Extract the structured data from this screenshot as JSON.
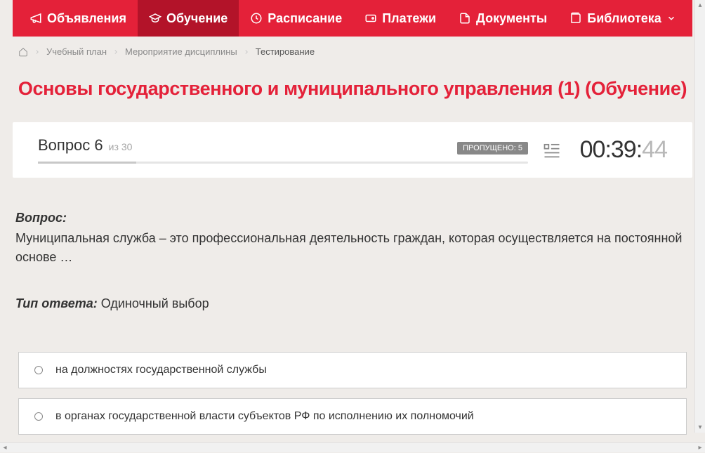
{
  "nav": [
    {
      "label": "Объявления",
      "icon": "megaphone-icon"
    },
    {
      "label": "Обучение",
      "icon": "graduation-icon",
      "active": true
    },
    {
      "label": "Расписание",
      "icon": "clock-icon"
    },
    {
      "label": "Платежи",
      "icon": "wallet-icon"
    },
    {
      "label": "Документы",
      "icon": "document-icon"
    },
    {
      "label": "Библиотека",
      "icon": "book-icon",
      "has_dropdown": true
    }
  ],
  "breadcrumb": {
    "items": [
      {
        "label": "Учебный план"
      },
      {
        "label": "Мероприятие дисциплины"
      }
    ],
    "current": "Тестирование"
  },
  "page_title": "Основы государственного и муниципального управления (1) (Обучение)",
  "question_header": {
    "word": "Вопрос",
    "number": "6",
    "of_prefix": "из",
    "total": "30",
    "skipped_label": "ПРОПУЩЕНО:",
    "skipped_count": "5",
    "progress_pct": 20
  },
  "timer": {
    "mm": "00",
    "ss": "39",
    "cs": "44"
  },
  "question": {
    "label": "Вопрос:",
    "text": "Муниципальная служба – это профессиональная деятельность граждан, которая осуществляется на постоянной основе …"
  },
  "answer_type": {
    "label": "Тип ответа:",
    "value": "Одиночный выбор"
  },
  "answers": [
    {
      "text": "на должностях государственной службы"
    },
    {
      "text": "в органах государственной власти субъектов РФ по исполнению их полномочий"
    }
  ]
}
